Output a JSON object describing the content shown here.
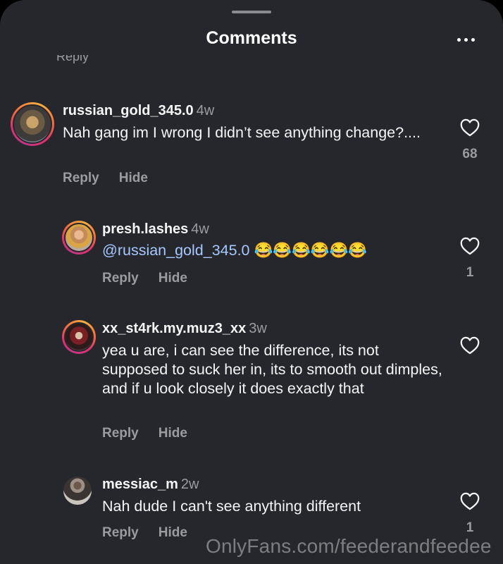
{
  "header": {
    "title": "Comments"
  },
  "previous_comment_stub": "Reply",
  "comments": [
    {
      "username": "russian_gold_345.0",
      "time": "4w",
      "text": "Nah gang im I wrong I didn’t see anything change?....",
      "like_count": "68",
      "reply_label": "Reply",
      "hide_label": "Hide"
    },
    {
      "username": "presh.lashes",
      "time": "4w",
      "mention": "@russian_gold_345.0",
      "text": "😂😂😂😂😂😂",
      "like_count": "1",
      "reply_label": "Reply",
      "hide_label": "Hide"
    },
    {
      "username": "xx_st4rk.my.muz3_xx",
      "time": "3w",
      "text": "yea u are, i can see the difference, its not supposed to suck her in, its to smooth out dimples, and if u look closely it does exactly that",
      "like_count": "",
      "reply_label": "Reply",
      "hide_label": "Hide"
    },
    {
      "username": "messiac_m",
      "time": "2w",
      "text": "Nah dude I can't see anything different",
      "like_count": "1",
      "reply_label": "Reply",
      "hide_label": "Hide"
    }
  ],
  "watermark": "OnlyFans.com/feederandfeedee",
  "colors": {
    "background": "#25272c",
    "muted_text": "#9a9ca0",
    "mention": "#a7c7ff"
  },
  "icons": {
    "like": "heart-outline-icon",
    "more": "more-horizontal-icon"
  }
}
